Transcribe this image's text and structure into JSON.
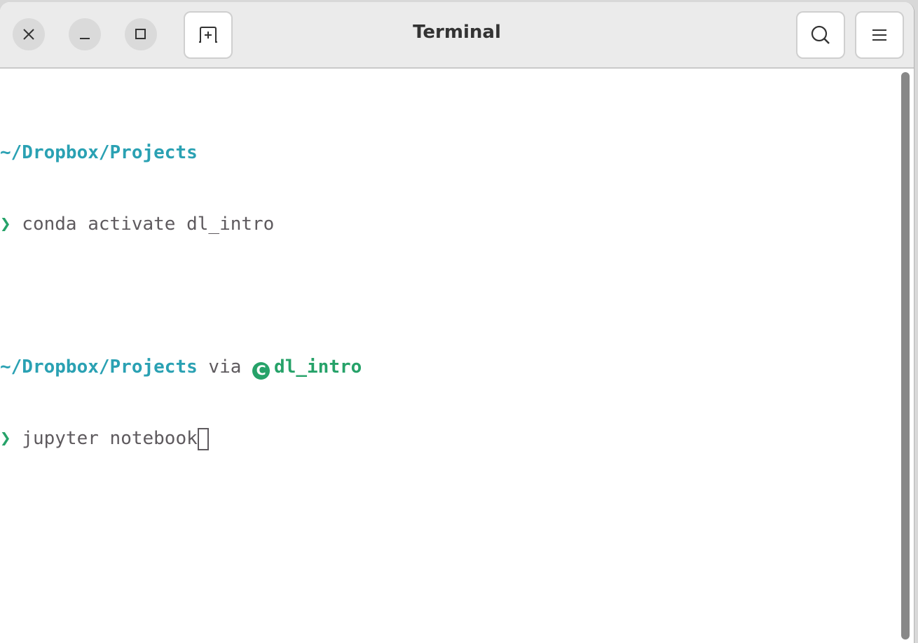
{
  "window": {
    "title": "Terminal"
  },
  "titlebar": {
    "close_icon": "close-icon",
    "minimize_icon": "minimize-icon",
    "maximize_icon": "maximize-icon",
    "new_tab_icon": "new-tab-icon",
    "search_icon": "search-icon",
    "menu_icon": "hamburger-menu-icon"
  },
  "terminal": {
    "lines": [
      {
        "path": "~/Dropbox/Projects"
      },
      {
        "prompt": "❯",
        "command": " conda activate dl_intro"
      },
      {
        "path": "~/Dropbox/Projects",
        "via": " via ",
        "env_icon": "C",
        "env": "dl_intro"
      },
      {
        "prompt": "❯",
        "command": " jupyter notebook"
      }
    ]
  },
  "colors": {
    "path": "#2aa1b3",
    "prompt": "#26a269",
    "text": "#5e5a5e"
  }
}
